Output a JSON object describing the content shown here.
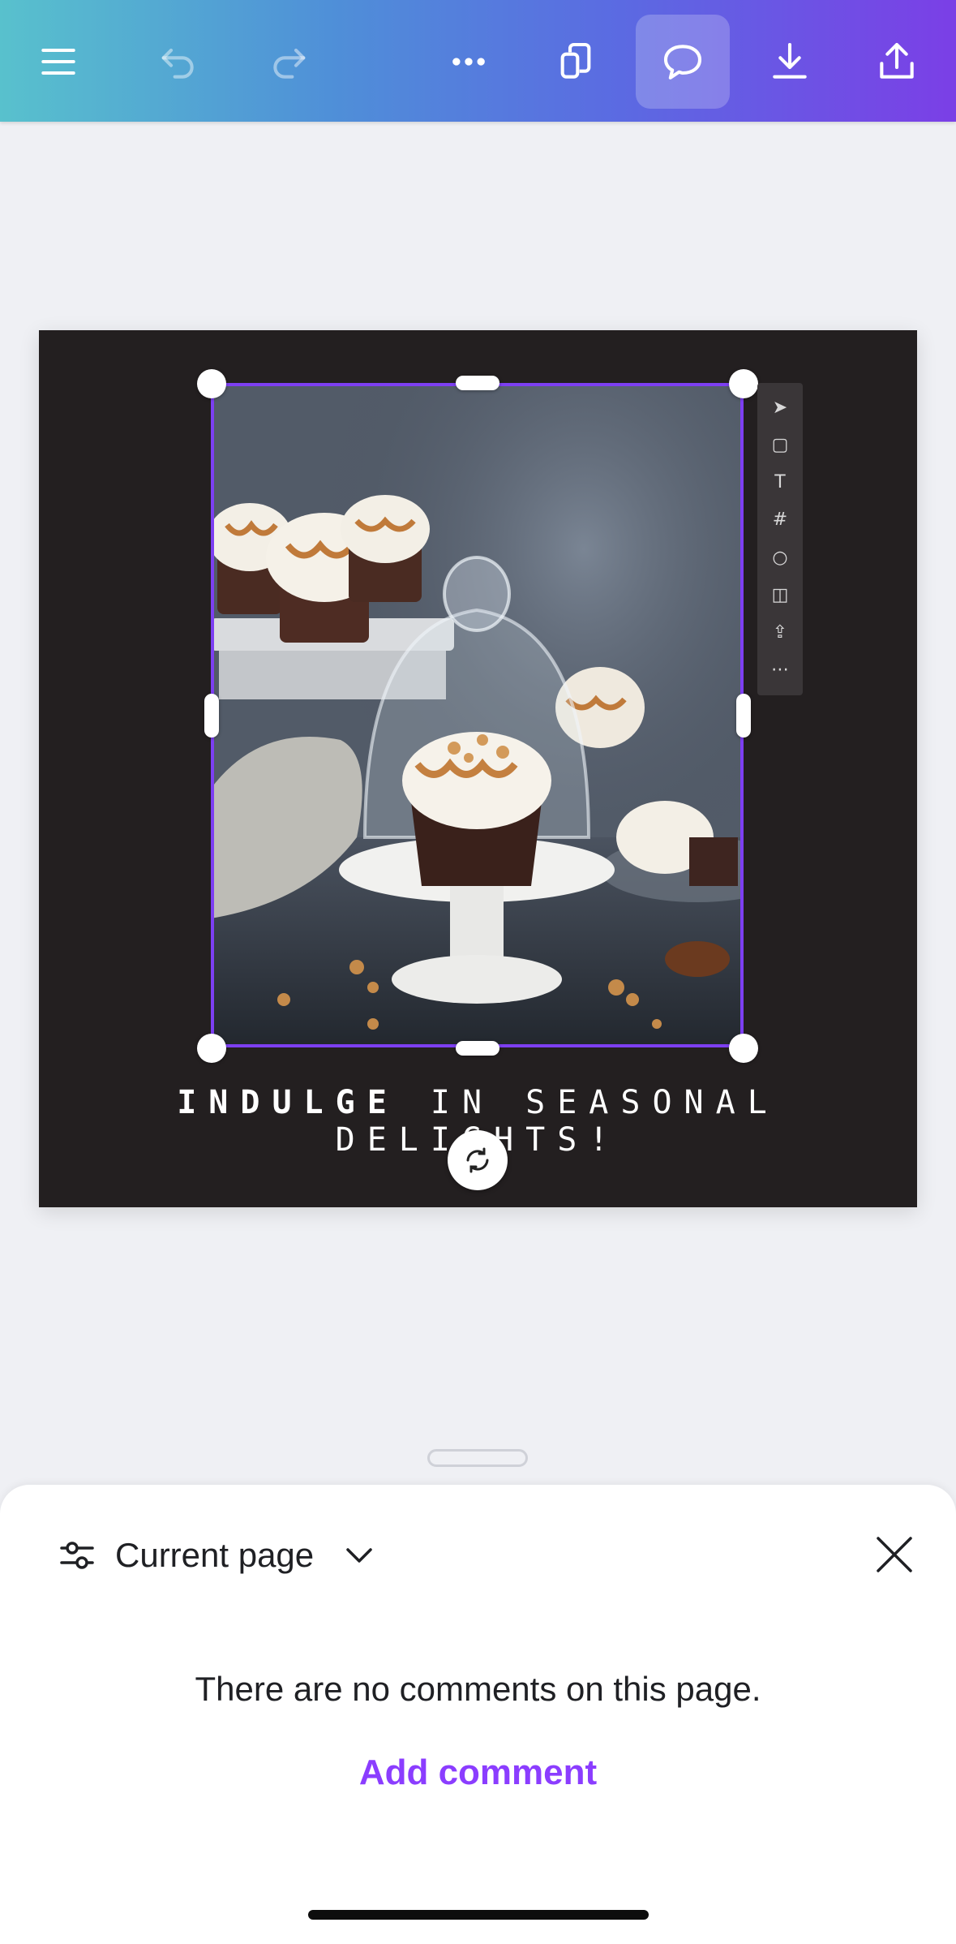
{
  "toolbar": {
    "icons": [
      "menu-icon",
      "undo-icon",
      "redo-icon",
      "more-icon",
      "copy-pages-icon",
      "comment-icon",
      "download-icon",
      "share-icon"
    ],
    "active": "comment-icon",
    "gradient": [
      "#58c1cd",
      "#7b3fe6"
    ]
  },
  "canvas": {
    "background": "#231f20",
    "selection_color": "#7d3ff2",
    "caption_bold": "INDULGE",
    "caption_rest": " IN SEASONAL DELIGHTS!",
    "side_tools": [
      "cursor-icon",
      "page-icon",
      "text-icon",
      "grid-icon",
      "circle-icon",
      "sticky-icon",
      "upload-icon",
      "more-icon"
    ]
  },
  "comments_panel": {
    "filter_label": "Current page",
    "empty_message": "There are no comments on this page.",
    "add_comment_label": "Add comment",
    "accent": "#8b3dff"
  }
}
